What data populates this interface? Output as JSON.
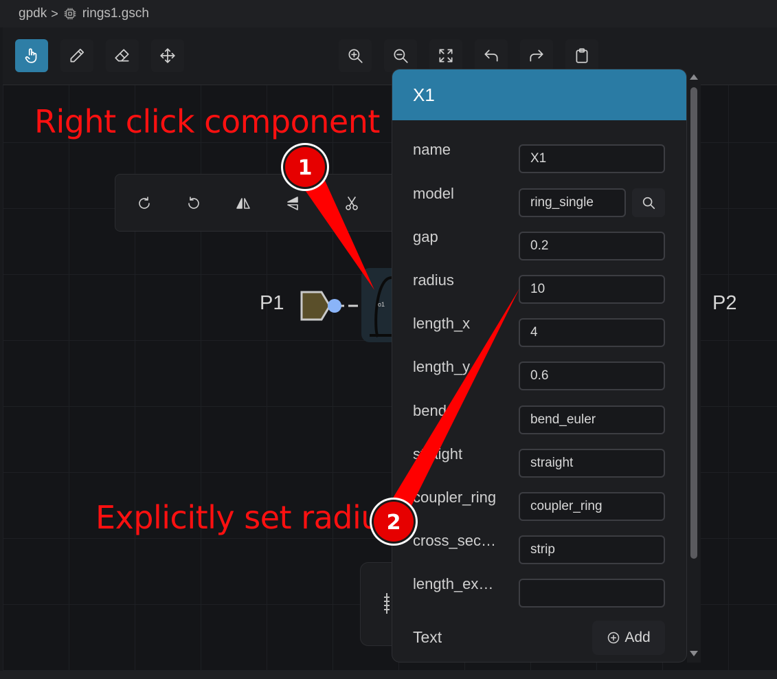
{
  "breadcrumb": {
    "root": "gpdk",
    "separator": ">",
    "file": "rings1.gsch"
  },
  "toolbar": {
    "left_tools": [
      "hand-pointer-icon",
      "pencil-icon",
      "eraser-icon",
      "move-arrows-icon"
    ],
    "center_tools": [
      "zoom-in-icon",
      "zoom-out-icon",
      "fit-screen-icon",
      "undo-icon",
      "redo-icon",
      "clipboard-icon"
    ],
    "active_tool": "hand-pointer-icon"
  },
  "context_toolbar": [
    "rotate-cw-icon",
    "rotate-ccw-icon",
    "flip-horizontal-icon",
    "flip-vertical-icon",
    "cut-icon"
  ],
  "circuit": {
    "port_left": "P1",
    "port_right": "P2",
    "pin_label": "o1"
  },
  "annotations": {
    "step1_text": "Right click component",
    "step1_number": "1",
    "step2_text": "Explicitly set radius",
    "step2_number": "2"
  },
  "panel": {
    "title": "X1",
    "properties": [
      {
        "label": "name",
        "value": "X1"
      },
      {
        "label": "model",
        "value": "ring_single"
      },
      {
        "label": "gap",
        "value": "0.2"
      },
      {
        "label": "radius",
        "value": "10"
      },
      {
        "label": "length_x",
        "value": "4"
      },
      {
        "label": "length_y",
        "value": "0.6"
      },
      {
        "label": "bend",
        "value": "bend_euler"
      },
      {
        "label": "straight",
        "value": "straight"
      },
      {
        "label": "coupler_ring",
        "value": "coupler_ring"
      },
      {
        "label": "cross_sec…",
        "value": "strip"
      },
      {
        "label": "length_ex…",
        "value": ""
      }
    ],
    "text_label": "Text",
    "add_label": "Add"
  },
  "colors": {
    "accent": "#2e7ea6",
    "annotation": "#ff1010",
    "port_fill": "#5a4f2a",
    "pin": "#8ab4f8"
  }
}
